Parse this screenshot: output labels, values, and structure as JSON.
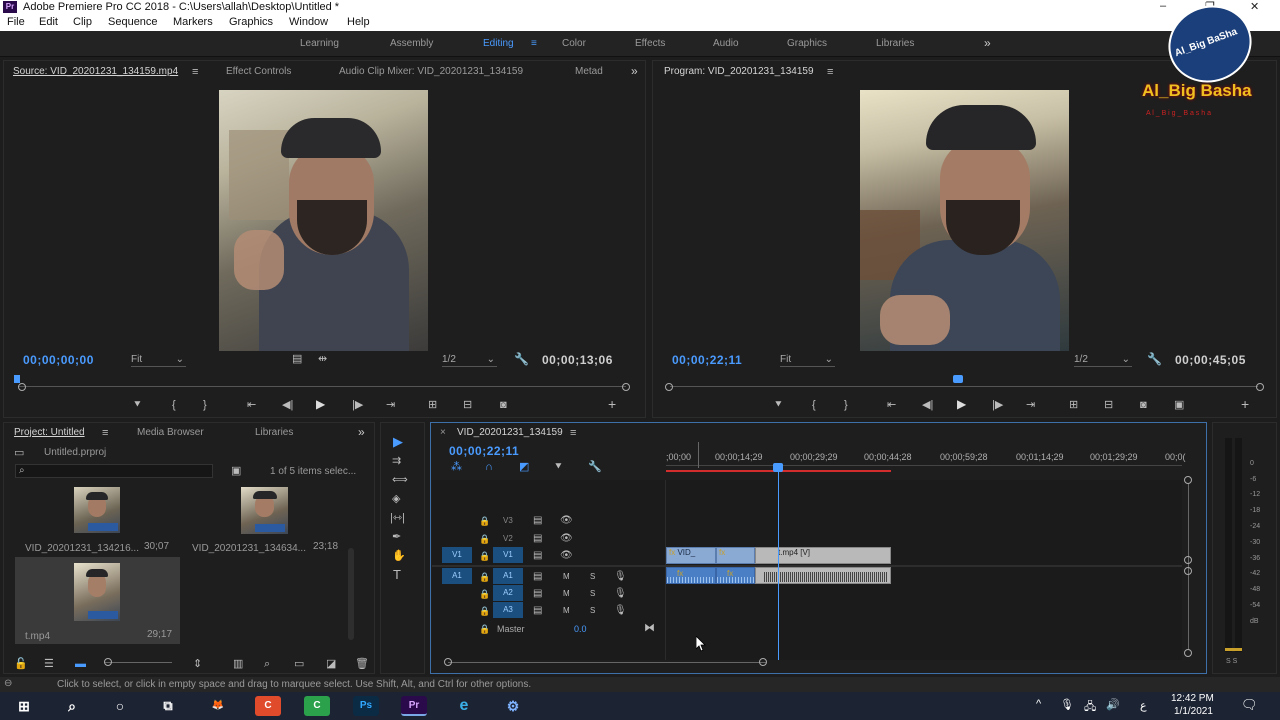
{
  "app": {
    "logo": "Pr",
    "title": "Adobe Premiere Pro CC 2018 - C:\\Users\\allah\\Desktop\\Untitled *",
    "win_min": "–",
    "win_max": "❐",
    "win_close": "✕"
  },
  "menu": [
    "File",
    "Edit",
    "Clip",
    "Sequence",
    "Markers",
    "Graphics",
    "Window",
    "Help"
  ],
  "workspaces": {
    "items": [
      "Learning",
      "Assembly",
      "Editing",
      "Color",
      "Effects",
      "Audio",
      "Graphics",
      "Libraries"
    ],
    "active": "Editing",
    "more": "»"
  },
  "source_panel": {
    "tabs": [
      "Source: VID_20201231_134159.mp4",
      "Effect Controls",
      "Audio Clip Mixer: VID_20201231_134159",
      "Metad"
    ],
    "more": "»",
    "timecode": "00;00;00;00",
    "fit": "Fit",
    "resolution": "1/2",
    "duration": "00;00;13;06"
  },
  "program_panel": {
    "tab": "Program: VID_20201231_134159",
    "timecode": "00;00;22;11",
    "fit": "Fit",
    "resolution": "1/2",
    "duration": "00;00;45;05"
  },
  "project_panel": {
    "tabs": [
      "Project: Untitled",
      "Media Browser",
      "Libraries"
    ],
    "more": "»",
    "file": "Untitled.prproj",
    "items_count": "1 of 5 items selec...",
    "items": [
      {
        "name": "VID_20201231_134216...",
        "duration": "30;07"
      },
      {
        "name": "VID_20201231_134634...",
        "duration": "23;18"
      },
      {
        "name": "t.mp4",
        "duration": "29;17"
      }
    ]
  },
  "timeline": {
    "close": "×",
    "sequence": "VID_20201231_134159",
    "timecode": "00;00;22;11",
    "ruler": [
      ";00;00",
      "00;00;14;29",
      "00;00;29;29",
      "00;00;44;28",
      "00;00;59;28",
      "00;01;14;29",
      "00;01;29;29",
      "00;0("
    ],
    "tracks": {
      "v3": "V3",
      "v2": "V2",
      "v1": "V1",
      "a1": "A1",
      "a2": "A2",
      "a3": "A3",
      "src_v1": "V1",
      "src_a1": "A1",
      "mute": "M",
      "solo": "S",
      "master": "Master",
      "master_value": "0.0"
    },
    "clips": {
      "fx": "fx",
      "v_clip1": "VID_",
      "v_clip3": "t.mp4 [V]"
    }
  },
  "meter_scale": [
    "0",
    "-6",
    "-12",
    "-18",
    "-24",
    "-30",
    "-36",
    "-42",
    "-48",
    "-54",
    "dB"
  ],
  "meter_solo": "S S",
  "status": "Click to select, or click in empty space and drag to marquee select. Use Shift, Alt, and Ctrl for other options.",
  "watermark": {
    "badge_text": "Al_Big BaSha",
    "channel": "Al_Big Basha",
    "sub": "A l _ B i g _ B a s h a"
  },
  "taskbar": {
    "apps": [
      "⊞",
      "⌕",
      "○",
      "⧉",
      "🦊",
      "C",
      "C",
      "Ps",
      "Pr",
      "e",
      "⚙"
    ],
    "lang": "ع",
    "time": "12:42 PM",
    "date": "1/1/2021"
  },
  "colors": {
    "accent": "#4a9bff",
    "playhead": "#4a9bff",
    "in_out": "#d42d2d"
  }
}
